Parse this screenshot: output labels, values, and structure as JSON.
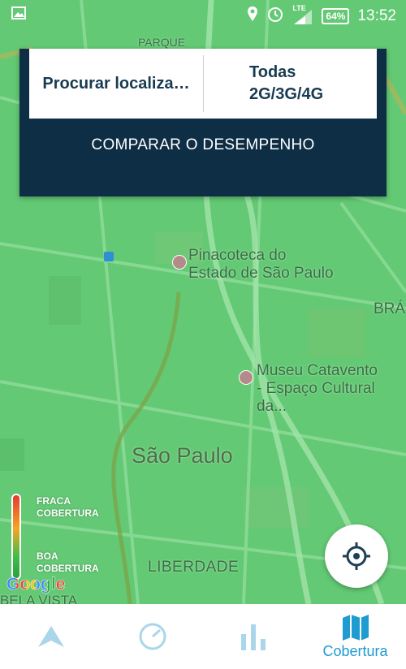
{
  "status": {
    "time": "13:52",
    "battery": "64%",
    "network": "LTE"
  },
  "card": {
    "search_label": "Procurar localiza…",
    "network_line1": "Todas",
    "network_line2": "2G/3G/4G",
    "compare_label": "COMPARAR O DESEMPENHO"
  },
  "map": {
    "labels": {
      "parque": "PARQUE",
      "pinacoteca_1": "Pinacoteca do",
      "pinacoteca_2": "Estado de São Paulo",
      "museu_1": "Museu Catavento",
      "museu_2": "- Espaço Cultural da...",
      "sao_paulo": "São Paulo",
      "liberdade": "LIBERDADE",
      "bela_vista": "BELA VISTA",
      "bras": "BRÁ"
    }
  },
  "legend": {
    "weak": "FRACA\nCOBERTURA",
    "good": "BOA\nCOBERTURA"
  },
  "google_logo": "Google",
  "nav": {
    "items": [
      {
        "label": "",
        "icon": "navigation-arrow-icon"
      },
      {
        "label": "",
        "icon": "speedometer-icon"
      },
      {
        "label": "",
        "icon": "bar-chart-icon"
      },
      {
        "label": "Cobertura",
        "icon": "map-icon"
      }
    ],
    "active_index": 3,
    "active_color": "#1e9bd1"
  },
  "colors": {
    "card_bg": "#0e2e45",
    "map_green": "#63c974",
    "accent": "#1e9bd1"
  }
}
